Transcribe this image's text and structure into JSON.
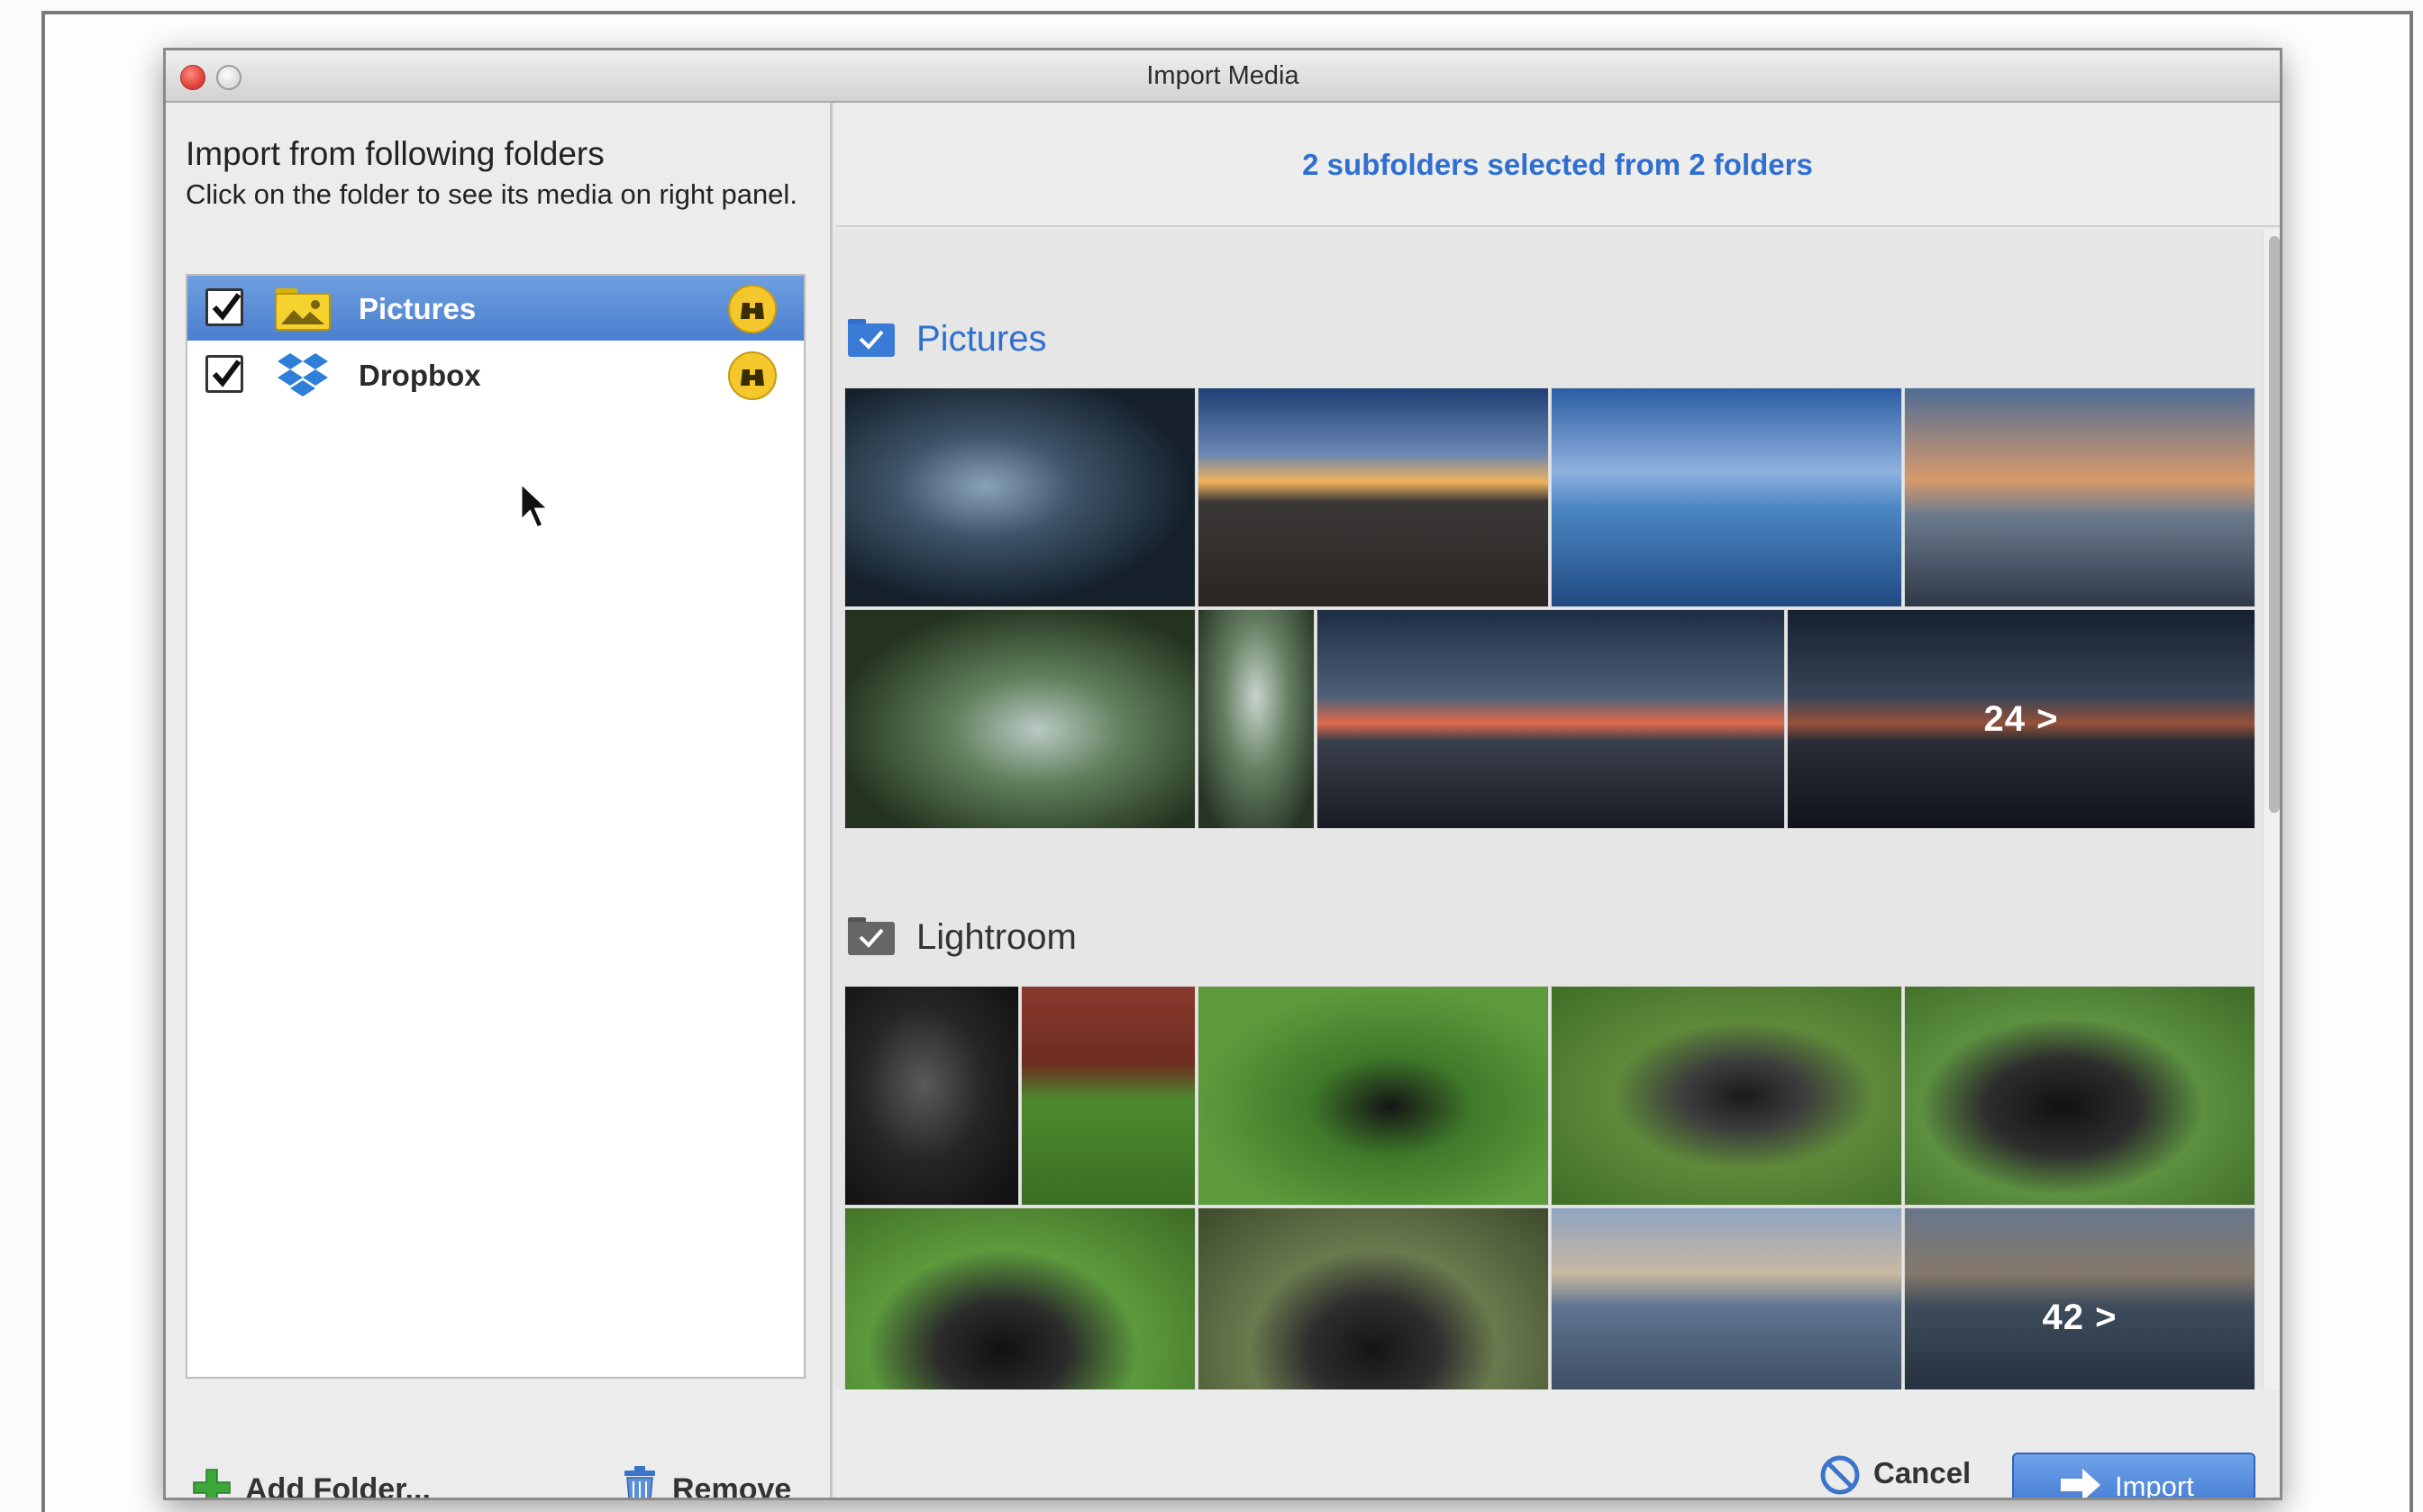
{
  "window": {
    "title": "Import Media"
  },
  "left_panel": {
    "heading": "Import from following folders",
    "subheading": "Click on the folder to see its media on right panel.",
    "folders": [
      {
        "name": "Pictures",
        "checked": true,
        "selected": true,
        "icon": "pictures-folder-icon"
      },
      {
        "name": "Dropbox",
        "checked": true,
        "selected": false,
        "icon": "dropbox-icon"
      }
    ],
    "add_folder_label": "Add Folder...",
    "remove_label": "Remove"
  },
  "right_panel": {
    "summary": "2 subfolders selected from 2 folders",
    "groups": [
      {
        "name": "Pictures",
        "more_label": "24 >",
        "thumbnails": [
          "sci-fi woman on vehicle",
          "rocky shore at sunset",
          "pier over surf",
          "pier at dusk",
          "forest waterfall",
          "waterfall detail",
          "pier silhouette at sunset",
          "pier silhouette at sunset"
        ]
      },
      {
        "name": "Lightroom",
        "more_label": "42 >",
        "thumbnails": [
          "black dog close-up",
          "black dog by fence",
          "two black dogs on grass",
          "hand holding lens filter",
          "camera with lens on grass",
          "camera on grass",
          "camera on rock",
          "camera on tripod at sea",
          "camera on tripod at sea"
        ]
      }
    ],
    "cancel_label": "Cancel",
    "import_label": "Import"
  },
  "colors": {
    "accent": "#2f6fd0",
    "selection": "#5a8fd8",
    "binoculars": "#f4c82c"
  }
}
